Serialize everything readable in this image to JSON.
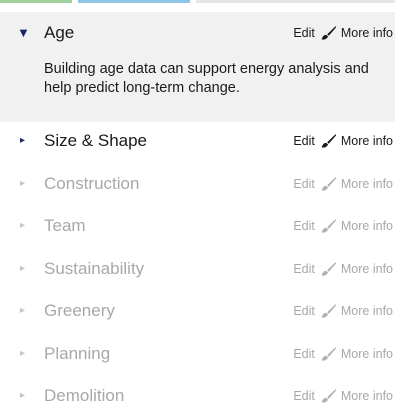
{
  "colors": {
    "expanded_bg": "#f1f1f2",
    "active_text": "#1a1a1a",
    "dim_text": "#a8a8a8",
    "caret_active": "#1a2a6c",
    "caret_dim": "#c4c4c4"
  },
  "sections": [
    {
      "label": "Age",
      "edit": "Edit",
      "more": "More info",
      "state": "expanded",
      "description": "Building age data can support energy analysis and help predict long-term change."
    },
    {
      "label": "Size & Shape",
      "edit": "Edit",
      "more": "More info",
      "state": "active"
    },
    {
      "label": "Construction",
      "edit": "Edit",
      "more": "More info",
      "state": "dim"
    },
    {
      "label": "Team",
      "edit": "Edit",
      "more": "More info",
      "state": "dim"
    },
    {
      "label": "Sustainability",
      "edit": "Edit",
      "more": "More info",
      "state": "dim"
    },
    {
      "label": "Greenery",
      "edit": "Edit",
      "more": "More info",
      "state": "dim"
    },
    {
      "label": "Planning",
      "edit": "Edit",
      "more": "More info",
      "state": "dim"
    },
    {
      "label": "Demolition",
      "edit": "Edit",
      "more": "More info",
      "state": "dim"
    }
  ],
  "icons": {
    "expanded_caret": "caret-down-icon",
    "collapsed_caret": "caret-right-icon",
    "edit_icon": "paintbrush-icon"
  }
}
